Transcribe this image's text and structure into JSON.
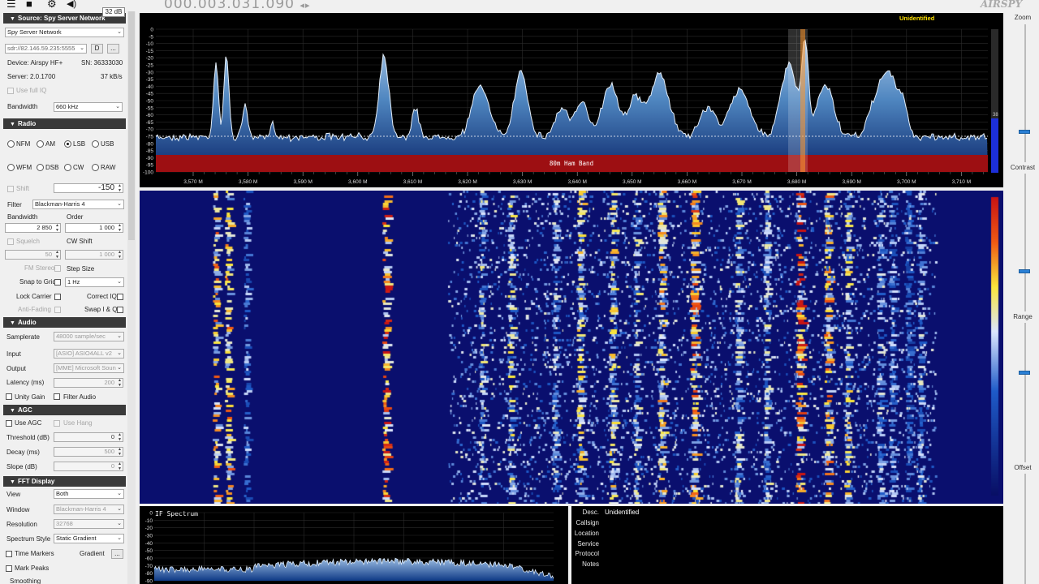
{
  "toolbar": {
    "frequency": "000.003.031.090",
    "db_tooltip": "32 dB",
    "brand": "AIRSPY"
  },
  "source": {
    "title": "Source: Spy Server Network",
    "type": "Spy Server Network",
    "uri": "sdr://82.146.59.235:5555",
    "connect_btn": "D",
    "menu_btn": "...",
    "device": "Device: Airspy HF+",
    "serial": "SN: 36333030",
    "server": "Server: 2.0.1700",
    "rate": "37 kB/s",
    "use_full_iq": "Use full IQ",
    "bandwidth_label": "Bandwidth",
    "bandwidth_value": "660 kHz"
  },
  "radio": {
    "title": "Radio",
    "modes_row1": [
      "NFM",
      "AM",
      "LSB",
      "USB"
    ],
    "modes_row2": [
      "WFM",
      "DSB",
      "CW",
      "RAW"
    ],
    "selected_mode": "LSB",
    "shift_label": "Shift",
    "shift_value": "-150",
    "filter_label": "Filter",
    "filter_value": "Blackman-Harris 4",
    "bandwidth_label": "Bandwidth",
    "order_label": "Order",
    "bandwidth_value": "2 850",
    "order_value": "1 000",
    "squelch_label": "Squelch",
    "cw_shift_label": "CW Shift",
    "squelch_value": "50",
    "cw_shift_value": "1 000",
    "fm_stereo": "FM Stereo",
    "step_size": "Step Size",
    "snap_to_grid": "Snap to Grid",
    "step_value": "1 Hz",
    "lock_carrier": "Lock Carrier",
    "correct_iq": "Correct IQ",
    "anti_fading": "Anti-Fading",
    "swap_iq": "Swap I & Q"
  },
  "audio": {
    "title": "Audio",
    "samplerate_label": "Samplerate",
    "samplerate_value": "48000 sample/sec",
    "input_label": "Input",
    "input_value": "[ASIO] ASIO4ALL v2",
    "output_label": "Output",
    "output_value": "[MME] Microsoft Soun",
    "latency_label": "Latency (ms)",
    "latency_value": "200",
    "unity_gain": "Unity Gain",
    "filter_audio": "Filter Audio"
  },
  "agc": {
    "title": "AGC",
    "use_agc": "Use AGC",
    "use_hang": "Use Hang",
    "threshold_label": "Threshold (dB)",
    "threshold_value": "0",
    "decay_label": "Decay (ms)",
    "decay_value": "500",
    "slope_label": "Slope (dB)",
    "slope_value": "0"
  },
  "fft": {
    "title": "FFT Display",
    "view_label": "View",
    "view_value": "Both",
    "window_label": "Window",
    "window_value": "Blackman-Harris 4",
    "resolution_label": "Resolution",
    "resolution_value": "32768",
    "style_label": "Spectrum Style",
    "style_value": "Static Gradient",
    "time_markers": "Time Markers",
    "gradient_label": "Gradient",
    "gradient_btn": "...",
    "mark_peaks": "Mark Peaks",
    "smoothing": "Smoothing"
  },
  "spectrum": {
    "unidentified": "Unidentified",
    "band_label": "80m Ham Band",
    "db_ticks": [
      "0",
      "-5",
      "-10",
      "-15",
      "-20",
      "-25",
      "-30",
      "-35",
      "-40",
      "-45",
      "-50",
      "-55",
      "-60",
      "-65",
      "-70",
      "-75",
      "-80",
      "-85",
      "-90",
      "-95",
      "-100"
    ],
    "freq_ticks": [
      "3,570 M",
      "3,580 M",
      "3,590 M",
      "3,600 M",
      "3,610 M",
      "3,620 M",
      "3,630 M",
      "3,640 M",
      "3,650 M",
      "3,660 M",
      "3,670 M",
      "3,680 M",
      "3,690 M",
      "3,700 M",
      "3,710 M"
    ],
    "meter_value": "38"
  },
  "if_spectrum": {
    "title": "IF Spectrum",
    "db_ticks": [
      "0",
      "-10",
      "-20",
      "-30",
      "-40",
      "-50",
      "-60",
      "-70",
      "-80",
      "-90"
    ]
  },
  "freq_info": {
    "desc_label": "Desc.",
    "desc_value": "Unidentified",
    "callsign_label": "Callsign",
    "location_label": "Location",
    "service_label": "Service",
    "protocol_label": "Protocol",
    "notes_label": "Notes"
  },
  "right_panel": {
    "zoom": "Zoom",
    "contrast": "Contrast",
    "range": "Range",
    "offset": "Offset"
  }
}
